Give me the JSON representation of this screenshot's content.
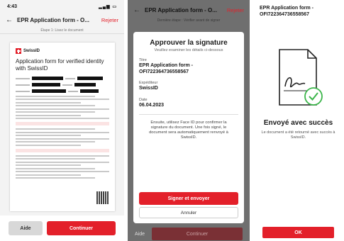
{
  "screen1": {
    "status_time": "4:43",
    "title": "EPR Application form - O...",
    "reject_label": "Rejeter",
    "step_text": "Étape 1: Lisez le document",
    "doc_brand": "SwissID",
    "doc_title": "Application form for verified identity with SwissID",
    "help_label": "Aide",
    "continue_label": "Continuer"
  },
  "screen2": {
    "title": "EPR Application form - O...",
    "reject_label": "Rejeter",
    "step_text": "Dernière étape : Vérifier avant de signer",
    "modal_title": "Approuver la signature",
    "modal_subtitle": "Veuillez examiner les détails ci-dessous",
    "label_title": "Titre",
    "value_title": "EPR Application form - OFI722364736558567",
    "label_sender": "Expéditeur",
    "value_sender": "SwissID",
    "label_date": "Date",
    "value_date": "06.04.2023",
    "info_text": "Ensuite, utilisez Face ID pour confirmer la signature du document. Une fois signé, le document sera automatiquement renvoyé à SwissID.",
    "sign_label": "Signer et envoyer",
    "cancel_label": "Annuler",
    "help_label": "Aide",
    "continue_label": "Continuer"
  },
  "screen3": {
    "header": "EPR Application form - OFI722364736558567",
    "success_title": "Envoyé avec succès",
    "success_text": "Le document a été retourné avec succès à SwissID.",
    "ok_label": "OK"
  },
  "colors": {
    "accent": "#e3202a",
    "success": "#3bb54a"
  }
}
